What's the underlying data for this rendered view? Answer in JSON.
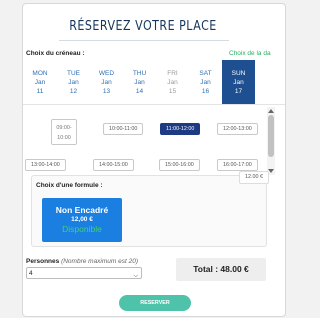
{
  "header": {
    "title": "RÉSERVEZ VOTRE PLACE"
  },
  "slots_section": {
    "label": "Choix du créneau :",
    "hint": "Choix de la da",
    "days": [
      {
        "dow": "MON",
        "month": "Jan",
        "date": "11",
        "state": "normal"
      },
      {
        "dow": "TUE",
        "month": "Jan",
        "date": "12",
        "state": "normal"
      },
      {
        "dow": "WED",
        "month": "Jan",
        "date": "13",
        "state": "normal"
      },
      {
        "dow": "THU",
        "month": "Jan",
        "date": "14",
        "state": "normal"
      },
      {
        "dow": "FRI",
        "month": "Jan",
        "date": "15",
        "state": "muted"
      },
      {
        "dow": "SAT",
        "month": "Jan",
        "date": "16",
        "state": "normal"
      },
      {
        "dow": "SUN",
        "month": "Jan",
        "date": "17",
        "state": "active"
      }
    ],
    "times": {
      "disabled": {
        "top": "09:00-",
        "bottom": "10:00"
      },
      "row1": [
        "10:00-11:00",
        "11:00-12:00",
        "12:00-13:00"
      ],
      "row2": [
        "13:00-14:00",
        "14:00-15:00",
        "15:00-16:00",
        "16:00-17:00"
      ],
      "selected": "11:00-12:00"
    }
  },
  "formule": {
    "label": "Choix d'une formule :",
    "price_box": "12.00 €",
    "card": {
      "name": "Non Encadré",
      "price": "12,00 €",
      "status": "Disponible"
    }
  },
  "persons": {
    "label": "Personnes",
    "hint": "(Nombre maximum est 20)",
    "value": "4"
  },
  "total": "Total : 48.00 €",
  "reserve_button": "RESERVER",
  "colors": {
    "primary": "#1d4f91",
    "selected_slot": "#1d3a82",
    "formule_card": "#1a7fe0",
    "available": "#3fd36b",
    "hint_green": "#27ae60",
    "reserve_button": "#4fc3a9"
  }
}
